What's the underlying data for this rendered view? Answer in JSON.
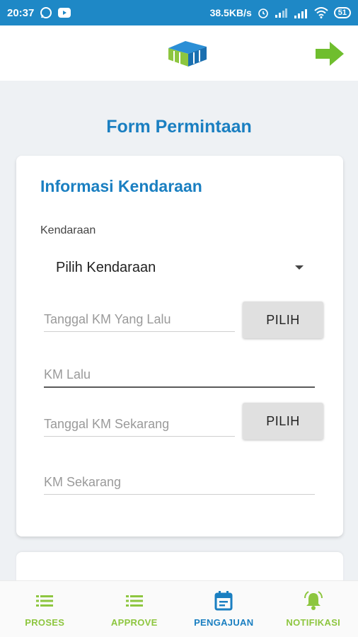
{
  "status_bar": {
    "time": "20:37",
    "net_speed": "38.5KB/s",
    "battery": "51"
  },
  "page": {
    "title": "Form Permintaan"
  },
  "vehicle_card": {
    "title": "Informasi Kendaraan",
    "vehicle_label": "Kendaraan",
    "vehicle_select_value": "Pilih Kendaraan",
    "prev_km_date_placeholder": "Tanggal KM Yang Lalu",
    "prev_km_date_button": "PILIH",
    "prev_km_placeholder": "KM Lalu",
    "current_km_date_placeholder": "Tanggal KM Sekarang",
    "current_km_date_button": "PILIH",
    "current_km_placeholder": "KM Sekarang"
  },
  "bottom_nav": [
    {
      "label": "PROSES",
      "icon": "list-icon",
      "active": false
    },
    {
      "label": "APPROVE",
      "icon": "list-icon",
      "active": false
    },
    {
      "label": "PENGAJUAN",
      "icon": "calendar-icon",
      "active": true
    },
    {
      "label": "NOTIFIKASI",
      "icon": "bell-icon",
      "active": false
    }
  ],
  "colors": {
    "status_bar": "#1e88c6",
    "primary_blue": "#1a7fc1",
    "accent_green": "#8dc63f"
  }
}
